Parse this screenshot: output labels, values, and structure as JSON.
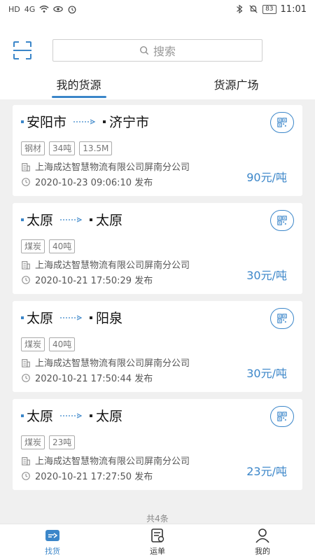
{
  "status_bar": {
    "left_icons": [
      "HD",
      "4G",
      "wifi",
      "eye",
      "alarm"
    ],
    "battery": "83",
    "time": "11:01"
  },
  "search": {
    "placeholder": "搜索"
  },
  "tabs": [
    {
      "label": "我的货源",
      "active": true
    },
    {
      "label": "货源广场",
      "active": false
    }
  ],
  "cards": [
    {
      "from": "安阳市",
      "to": "济宁市",
      "tags": [
        "钢材",
        "34吨",
        "13.5M"
      ],
      "company": "上海成达智慧物流有限公司屏南分公司",
      "time": "2020-10-23 09:06:10 发布",
      "price": "90元/吨"
    },
    {
      "from": "太原",
      "to": "太原",
      "tags": [
        "煤炭",
        "40吨"
      ],
      "company": "上海成达智慧物流有限公司屏南分公司",
      "time": "2020-10-21 17:50:29 发布",
      "price": "30元/吨"
    },
    {
      "from": "太原",
      "to": "阳泉",
      "tags": [
        "煤炭",
        "40吨"
      ],
      "company": "上海成达智慧物流有限公司屏南分公司",
      "time": "2020-10-21 17:50:44 发布",
      "price": "30元/吨"
    },
    {
      "from": "太原",
      "to": "太原",
      "tags": [
        "煤炭",
        "23吨"
      ],
      "company": "上海成达智慧物流有限公司屏南分公司",
      "time": "2020-10-21 17:27:50 发布",
      "price": "23元/吨"
    }
  ],
  "total": "共4条",
  "bottom_nav": [
    {
      "label": "找货",
      "icon": "truck-icon",
      "active": true
    },
    {
      "label": "运单",
      "icon": "waybill-icon",
      "active": false
    },
    {
      "label": "我的",
      "icon": "person-icon",
      "active": false
    }
  ],
  "colors": {
    "accent": "#3b86c9",
    "background": "#f0f0f0"
  }
}
